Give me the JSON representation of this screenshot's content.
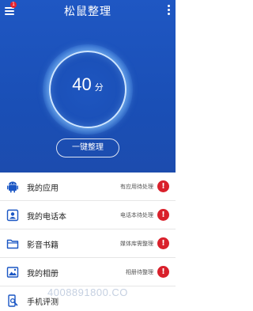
{
  "header": {
    "title": "松鼠整理",
    "notification_count": "1"
  },
  "score": {
    "value": "40",
    "unit": "分"
  },
  "optimize_label": "一键整理",
  "items": [
    {
      "label": "我的应用",
      "status": "有应用待处理",
      "icon": "android-icon"
    },
    {
      "label": "我的电话本",
      "status": "电话本待处理",
      "icon": "contacts-icon"
    },
    {
      "label": "影音书籍",
      "status": "媒体库需整理",
      "icon": "folder-icon"
    },
    {
      "label": "我的相册",
      "status": "相册待整理",
      "icon": "photo-icon"
    },
    {
      "label": "手机评测",
      "status": "",
      "icon": "phone-test-icon"
    }
  ],
  "warning_glyph": "!",
  "watermark": "4008891800.CO",
  "colors": {
    "header_bg": "#1f57c3",
    "warning": "#d9202b",
    "icon_blue": "#1a56c4"
  }
}
